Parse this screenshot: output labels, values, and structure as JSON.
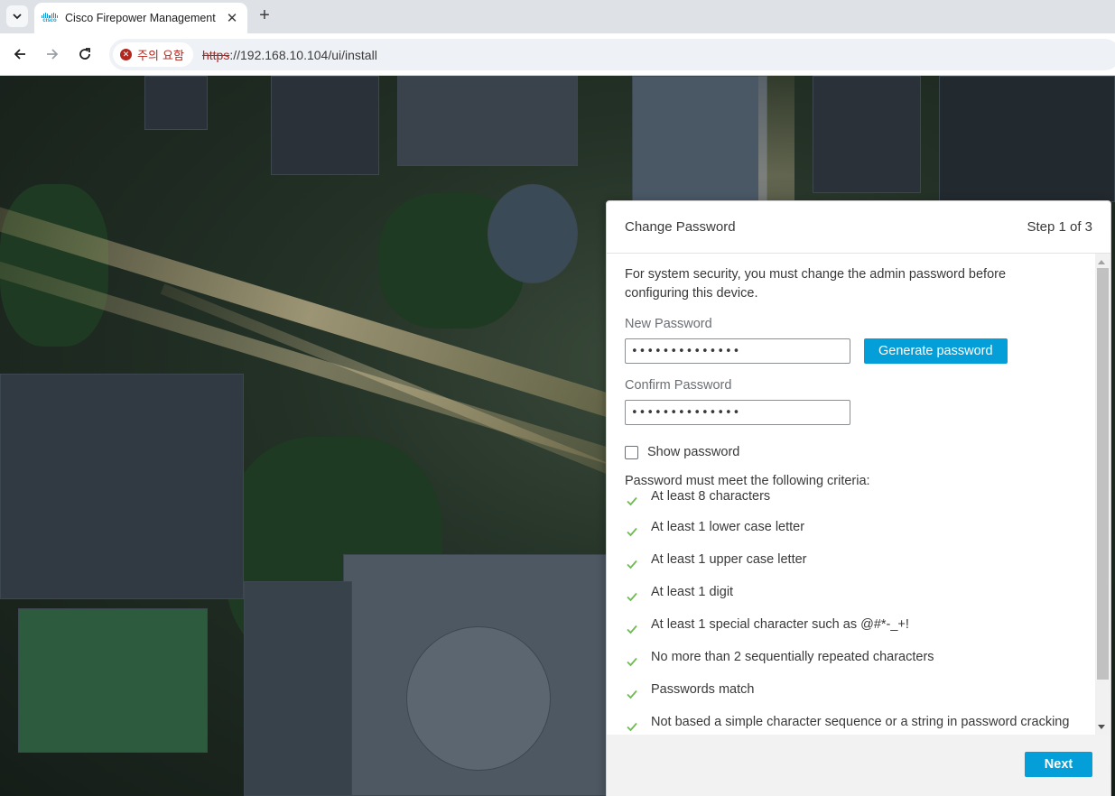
{
  "browser": {
    "tab": {
      "title": "Cisco Firepower Management",
      "favicon_word": "cisco"
    },
    "security_chip": "주의 요함",
    "url_scheme": "https",
    "url_rest": "://192.168.10.104/ui/install"
  },
  "dialog": {
    "title": "Change Password",
    "step": "Step 1 of 3",
    "intro": "For system security, you must change the admin password before configuring this device.",
    "new_password": {
      "label": "New Password",
      "value": "••••••••••••••"
    },
    "generate_label": "Generate password",
    "confirm_password": {
      "label": "Confirm Password",
      "value": "••••••••••••••"
    },
    "show_password": {
      "label": "Show password",
      "checked": false
    },
    "criteria_title": "Password must meet the following criteria:",
    "criteria": [
      {
        "text": "At least 8 characters",
        "met": true
      },
      {
        "text": "At least 1 lower case letter",
        "met": true
      },
      {
        "text": "At least 1 upper case letter",
        "met": true
      },
      {
        "text": "At least 1 digit",
        "met": true
      },
      {
        "text": "At least 1 special character such as @#*-_+!",
        "met": true
      },
      {
        "text": "No more than 2 sequentially repeated characters",
        "met": true
      },
      {
        "text": "Passwords match",
        "met": true
      },
      {
        "text": "Not based a simple character sequence or a string in password cracking",
        "met": true
      }
    ],
    "next_label": "Next"
  },
  "colors": {
    "accent": "#049fd9",
    "check": "#6abf4b",
    "warning": "#b3261e"
  }
}
